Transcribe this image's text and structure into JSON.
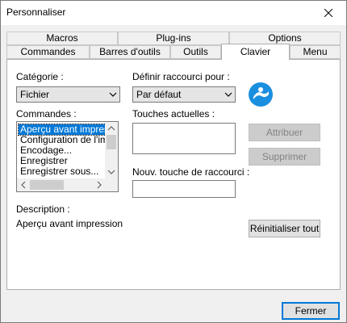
{
  "window": {
    "title": "Personnaliser"
  },
  "tabs_back": [
    {
      "label": "Macros"
    },
    {
      "label": "Plug-ins"
    },
    {
      "label": "Options"
    }
  ],
  "tabs_front": [
    {
      "label": "Commandes"
    },
    {
      "label": "Barres d'outils"
    },
    {
      "label": "Outils"
    },
    {
      "label": "Clavier"
    },
    {
      "label": "Menu"
    }
  ],
  "category": {
    "label": "Catégorie :",
    "value": "Fichier"
  },
  "shortcut_for": {
    "label": "Définir raccourci pour :",
    "value": "Par défaut"
  },
  "commands": {
    "label": "Commandes :",
    "items": [
      "Aperçu avant impression",
      "Configuration de l'impression...",
      "Encodage...",
      "Enregistrer",
      "Enregistrer sous..."
    ]
  },
  "current_keys": {
    "label": "Touches actuelles :"
  },
  "new_shortcut": {
    "label": "Nouv. touche de raccourci :",
    "value": ""
  },
  "buttons": {
    "assign": "Attribuer",
    "remove": "Supprimer",
    "reset_all": "Réinitialiser tout",
    "close": "Fermer"
  },
  "description": {
    "label": "Description :",
    "text": "Aperçu avant impression"
  },
  "icons": {
    "app": "app-logo-icon",
    "close": "close-icon"
  },
  "colors": {
    "accent": "#0078d7",
    "logo": "#1a8fe0"
  }
}
